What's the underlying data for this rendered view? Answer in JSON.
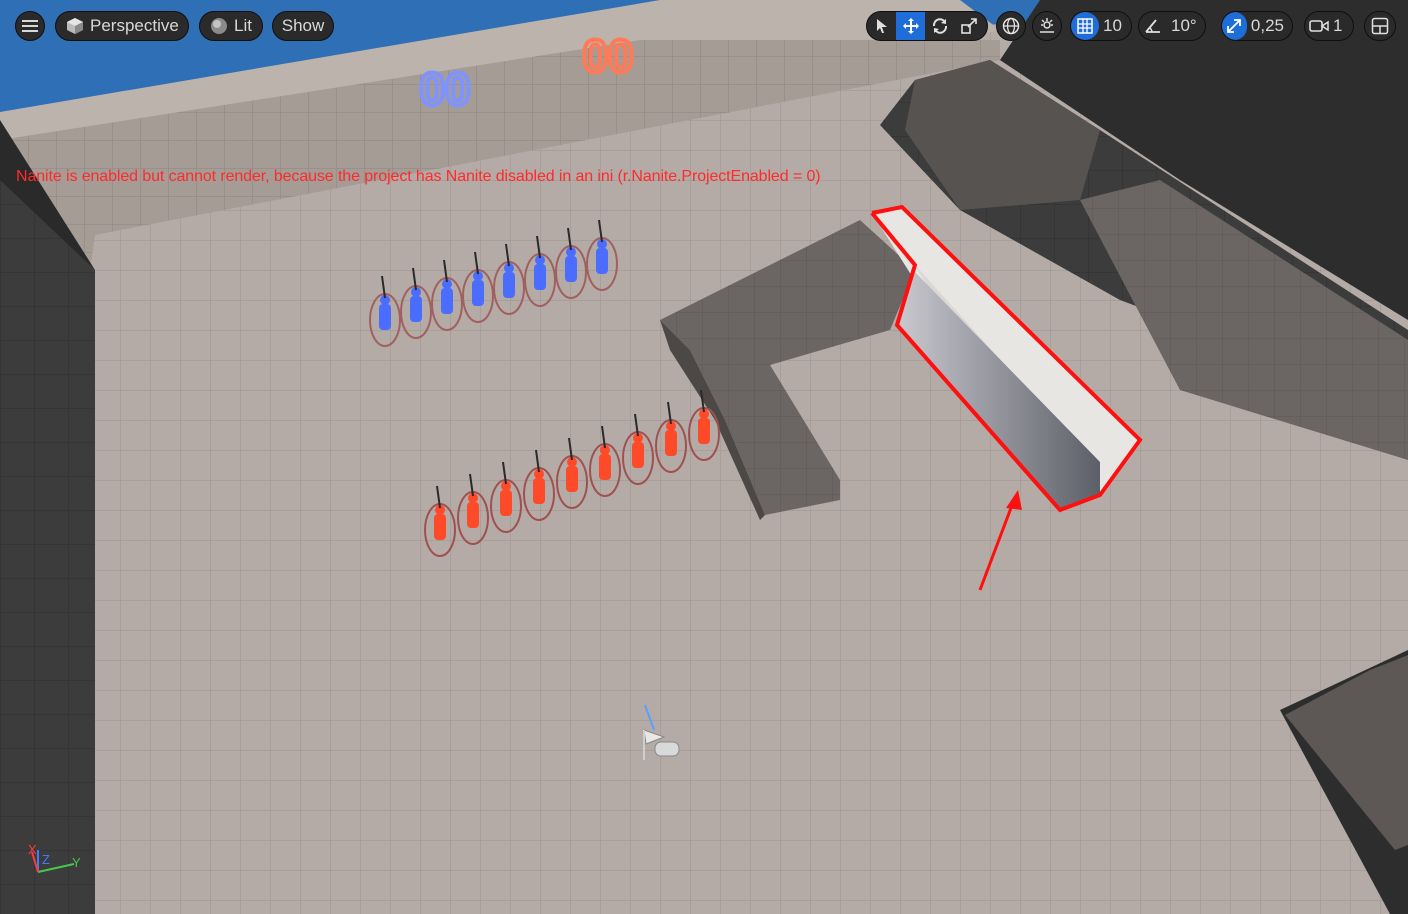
{
  "toolbar": {
    "menu_icon": "hamburger-menu-icon",
    "view_mode_label": "Perspective",
    "lighting_label": "Lit",
    "show_label": "Show",
    "transform_tools": [
      "select-arrow-icon",
      "move-icon",
      "rotate-icon",
      "scale-icon"
    ],
    "active_transform_tool": "move-icon",
    "world_local_icon": "globe-icon",
    "surface_snap_icon": "surface-snapping-icon",
    "grid_snap_value": "10",
    "rotation_snap_value": "10°",
    "scale_snap_value": "0,25",
    "camera_speed_value": "1",
    "layout_icon": "viewport-layout-icon"
  },
  "scene": {
    "score_blue": "00",
    "score_red": "00",
    "blue_color": "#4a6dff",
    "red_color": "#ff4a2a",
    "highlight_color": "#ff1010"
  },
  "warning": {
    "text": "Nanite is enabled but cannot render, because the project has Nanite disabled in an ini (r.Nanite.ProjectEnabled = 0)"
  },
  "axis": {
    "z": "Z",
    "y": "Y",
    "x": "X"
  }
}
